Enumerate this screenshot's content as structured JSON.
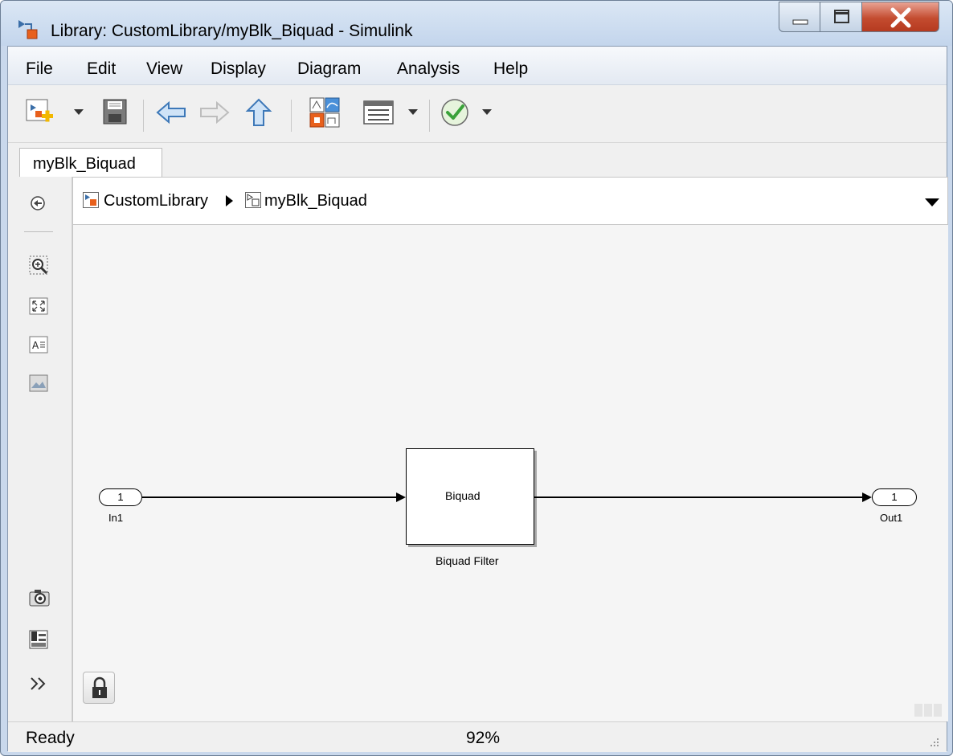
{
  "window": {
    "title": "Library: CustomLibrary/myBlk_Biquad - Simulink"
  },
  "menu": {
    "items": [
      "File",
      "Edit",
      "View",
      "Display",
      "Diagram",
      "Analysis",
      "Help"
    ]
  },
  "toolbar": {
    "icons": [
      "new-model-icon",
      "save-icon",
      "back-icon",
      "forward-icon",
      "up-icon",
      "library-browser-icon",
      "model-explorer-icon",
      "update-diagram-icon"
    ]
  },
  "tabs": [
    {
      "label": "myBlk_Biquad"
    }
  ],
  "breadcrumb": {
    "items": [
      "CustomLibrary",
      "myBlk_Biquad"
    ]
  },
  "diagram": {
    "inport": {
      "number": "1",
      "label": "In1"
    },
    "block": {
      "text": "Biquad",
      "label": "Biquad Filter"
    },
    "outport": {
      "number": "1",
      "label": "Out1"
    }
  },
  "status": {
    "text": "Ready",
    "zoom": "92%"
  },
  "colors": {
    "titlebar": "#c3d5ec",
    "close_button": "#c44c30",
    "canvas": "#f5f5f5",
    "accent_orange": "#e8601c"
  }
}
